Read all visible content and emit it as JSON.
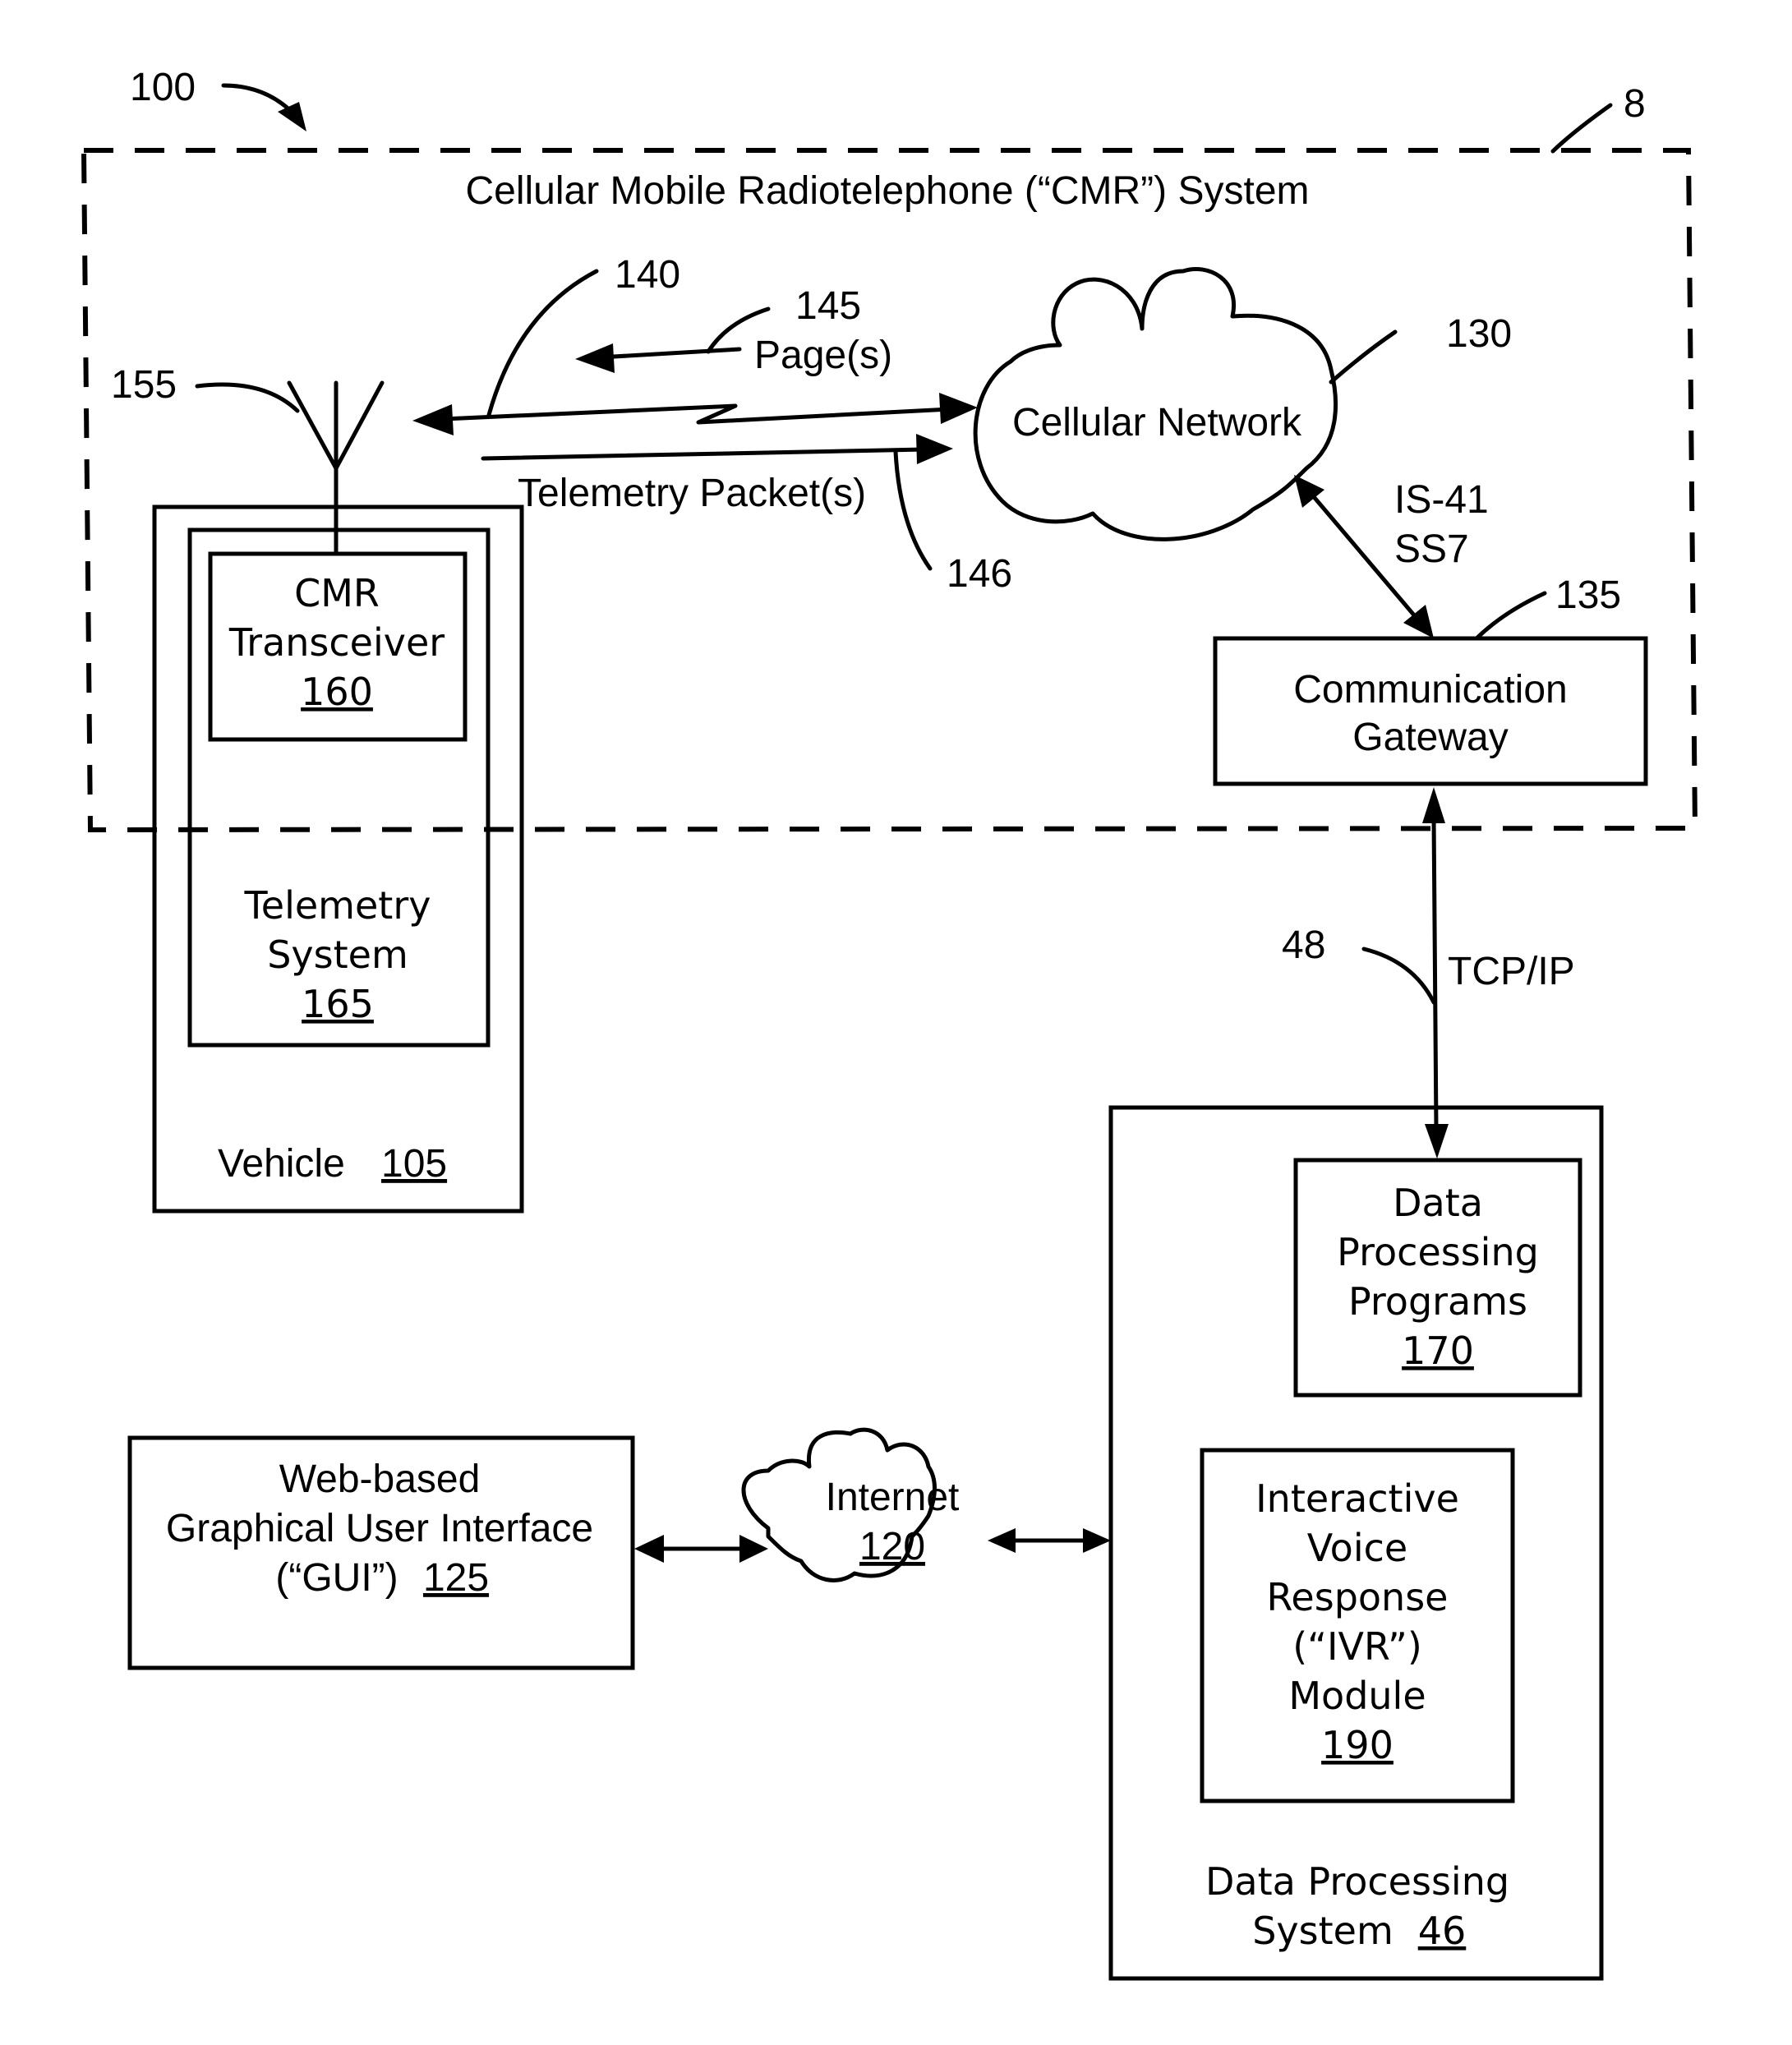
{
  "figure": {
    "ref": "100",
    "cmr_system": {
      "title": "Cellular Mobile Radiotelephone (“CMR”) System",
      "ref": "8"
    },
    "antenna": {
      "ref": "155"
    },
    "link": {
      "ref": "140"
    },
    "pages": {
      "ref": "145",
      "label": "Page(s)"
    },
    "telemetry_packets": {
      "ref": "146",
      "label": "Telemetry Packet(s)"
    },
    "cellular_network": {
      "label": "Cellular Network",
      "ref": "130"
    },
    "is41": {
      "line1": "IS-41",
      "line2": "SS7"
    },
    "gateway": {
      "line1": "Communication",
      "line2": "Gateway",
      "ref": "135"
    },
    "tcpip": {
      "label": "TCP/IP",
      "ref": "48"
    },
    "vehicle": {
      "label": "Vehicle",
      "ref": "105"
    },
    "cmr_transceiver": {
      "line1": "CMR",
      "line2": "Transceiver",
      "ref": "160"
    },
    "telemetry_system": {
      "line1": "Telemetry",
      "line2": "System",
      "ref": "165"
    },
    "dps": {
      "line1": "Data Processing",
      "line2": "System",
      "ref": "46"
    },
    "dpp": {
      "line1": "Data",
      "line2": "Processing",
      "line3": "Programs",
      "ref": "170"
    },
    "ivr": {
      "line1": "Interactive",
      "line2": "Voice",
      "line3": "Response",
      "line4": "(“IVR”)",
      "line5": "Module",
      "ref": "190"
    },
    "gui": {
      "line1": "Web-based",
      "line2": "Graphical User Interface",
      "line3": "(“GUI”)",
      "ref": "125"
    },
    "internet": {
      "label": "Internet",
      "ref": "120"
    }
  }
}
